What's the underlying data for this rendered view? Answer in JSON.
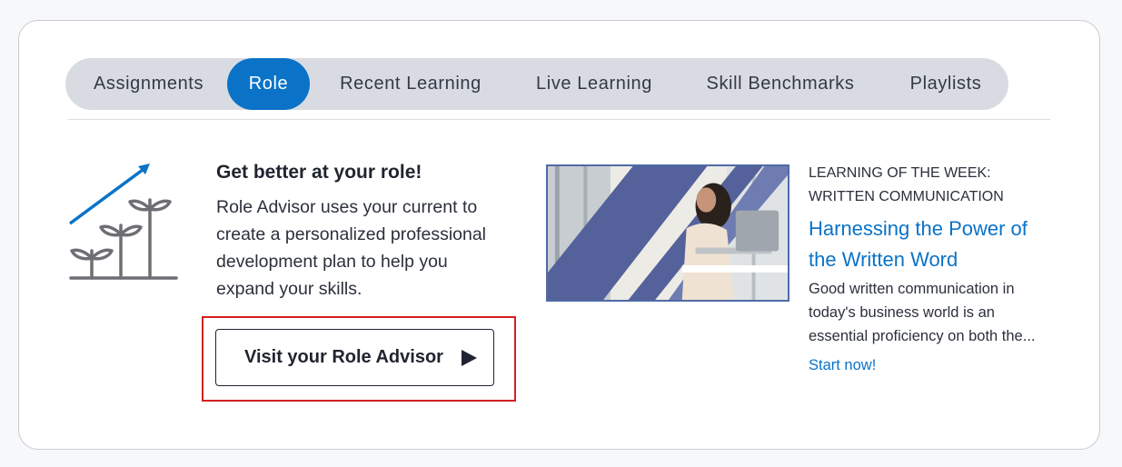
{
  "tabs": [
    {
      "label": "Assignments",
      "active": false
    },
    {
      "label": "Role",
      "active": true
    },
    {
      "label": "Recent Learning",
      "active": false
    },
    {
      "label": "Live Learning",
      "active": false
    },
    {
      "label": "Skill Benchmarks",
      "active": false
    },
    {
      "label": "Playlists",
      "active": false
    }
  ],
  "role_promo": {
    "icon": "growing-plants-chart-icon",
    "title": "Get better at your role!",
    "description_lines": [
      "Role Advisor uses your current to",
      "create a personalized professional",
      "development plan to help you",
      "expand your skills."
    ],
    "button_label": "Visit your Role Advisor",
    "button_icon": "play-icon"
  },
  "learning_of_the_week": {
    "kicker_lines": [
      "LEARNING OF THE WEEK:",
      "WRITTEN COMMUNICATION"
    ],
    "title_lines": [
      "Harnessing the Power of",
      "the Written Word"
    ],
    "description_lines": [
      "Good written communication in",
      "today's business world is an",
      "essential proficiency on both the..."
    ],
    "cta": "Start now!",
    "image": "woman-working-on-laptop-thumbnail"
  },
  "colors": {
    "accent": "#0a73c8",
    "tab_bar": "#d9dbe2",
    "highlight": "#d3201e",
    "thumb_band": "#55619a"
  }
}
